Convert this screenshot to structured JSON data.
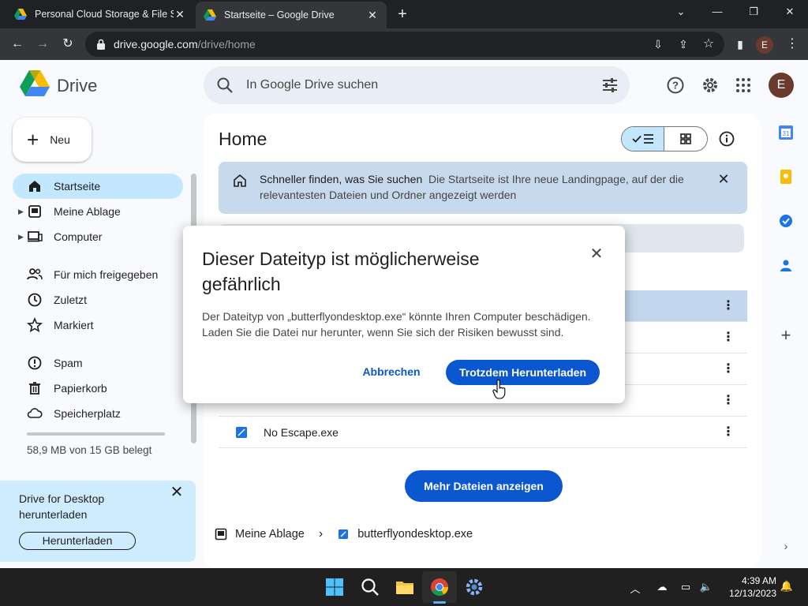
{
  "browser": {
    "tabs": [
      {
        "title": "Personal Cloud Storage & File Sh",
        "active": false
      },
      {
        "title": "Startseite – Google Drive",
        "active": true
      }
    ],
    "url_host": "drive.google.com",
    "url_path": "/drive/home",
    "profile_initial": "E"
  },
  "drive": {
    "app_name": "Drive",
    "search_placeholder": "In Google Drive suchen",
    "avatar_initial": "E",
    "new_label": "Neu",
    "nav": [
      {
        "label": "Startseite",
        "icon": "home-icon",
        "active": true
      },
      {
        "label": "Meine Ablage",
        "icon": "my-drive-icon",
        "expandable": true
      },
      {
        "label": "Computer",
        "icon": "computer-icon",
        "expandable": true
      },
      {
        "label": "Für mich freigegeben",
        "icon": "shared-people-icon"
      },
      {
        "label": "Zuletzt",
        "icon": "clock-icon"
      },
      {
        "label": "Markiert",
        "icon": "star-icon"
      },
      {
        "label": "Spam",
        "icon": "spam-icon"
      },
      {
        "label": "Papierkorb",
        "icon": "trash-icon"
      },
      {
        "label": "Speicherplatz",
        "icon": "cloud-icon"
      }
    ],
    "storage_text": "58,9 MB von 15 GB belegt",
    "promo": {
      "text": "Drive for Desktop herunterladen",
      "button": "Herunterladen"
    },
    "main": {
      "title": "Home",
      "banner_bold": "Schneller finden, was Sie suchen",
      "banner_text": "Die Startseite ist Ihre neue Landingpage, auf der die relevantesten Dateien und Ordner angezeigt werden",
      "visible_rows": [
        {
          "name": "",
          "selected": true
        },
        {
          "name": ""
        },
        {
          "name": ""
        },
        {
          "name": ""
        },
        {
          "name": "No Escape.exe"
        }
      ],
      "more_button": "Mehr Dateien anzeigen",
      "breadcrumb": {
        "root": "Meine Ablage",
        "file": "butterflyondesktop.exe"
      }
    }
  },
  "dialog": {
    "title": "Dieser Dateityp ist möglicherweise gefährlich",
    "body": "Der Dateityp von „butterflyondesktop.exe“ könnte Ihren Computer beschädigen. Laden Sie die Datei nur herunter, wenn Sie sich der Risiken bewusst sind.",
    "cancel": "Abbrechen",
    "confirm": "Trotzdem Herunterladen"
  },
  "taskbar": {
    "time": "4:39 AM",
    "date": "12/13/2023"
  },
  "colors": {
    "accent": "#0b57d0",
    "selected_nav": "#c2e7ff",
    "chrome_dark": "#202124"
  }
}
